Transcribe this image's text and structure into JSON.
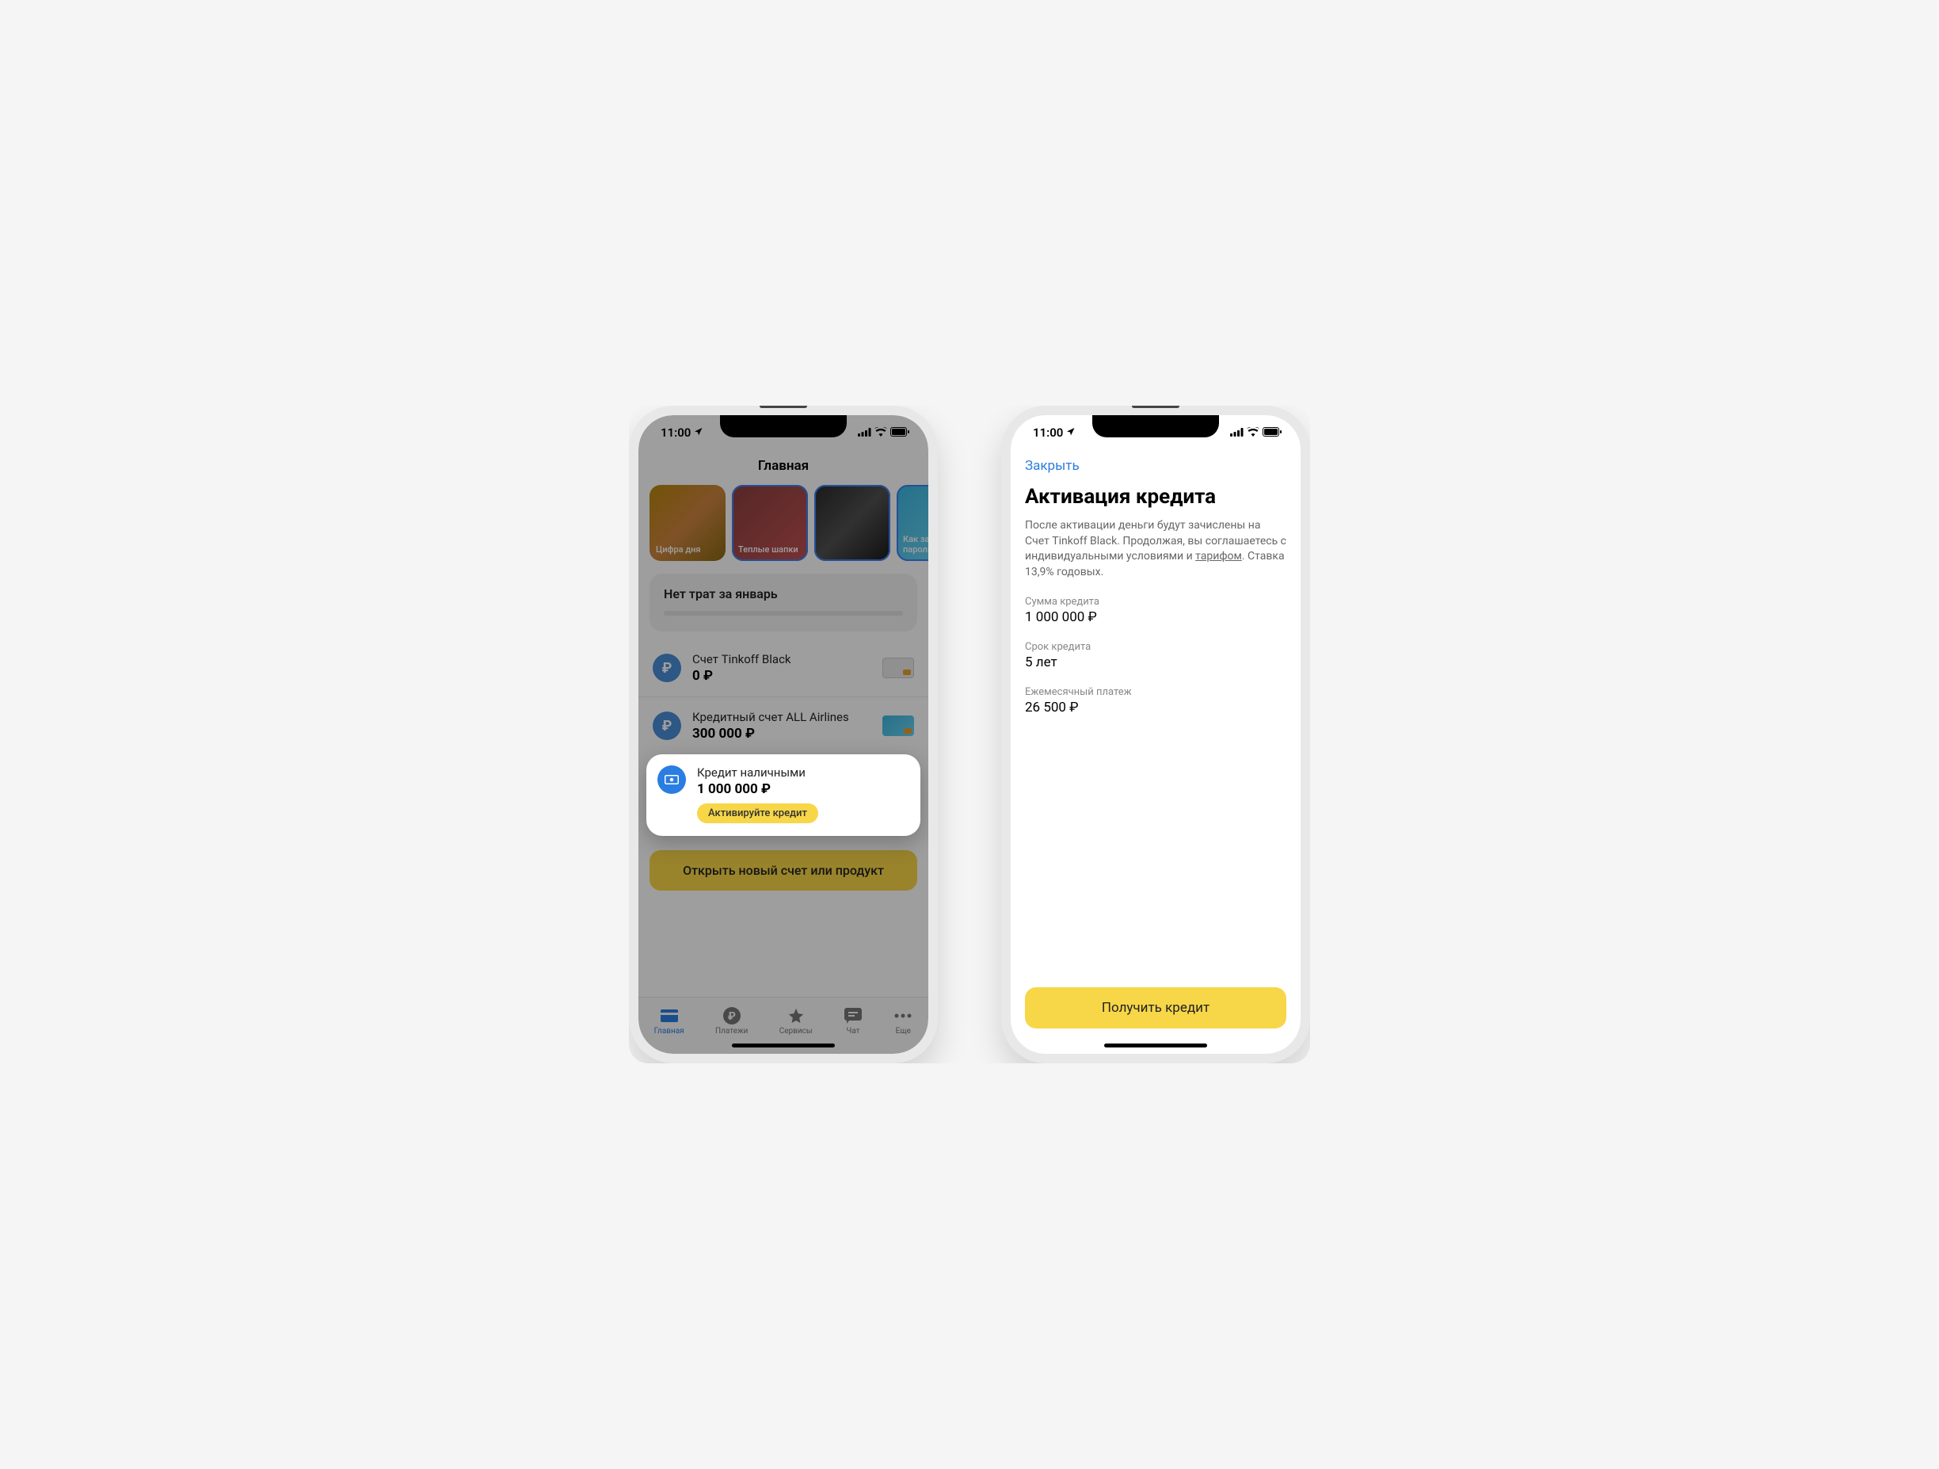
{
  "status": {
    "time": "11:00"
  },
  "left": {
    "header": "Главная",
    "stories": [
      {
        "label": "Цифра дня"
      },
      {
        "label": "Теплые шапки"
      },
      {
        "label": ""
      },
      {
        "label": "Как зап пароли"
      }
    ],
    "spend_title": "Нет трат за январь",
    "accounts": [
      {
        "name": "Счет Tinkoff Black",
        "balance": "0 ₽"
      },
      {
        "name": "Кредитный счет ALL Airlines",
        "balance": "300 000 ₽"
      }
    ],
    "highlight": {
      "name": "Кредит наличными",
      "balance": "1 000 000 ₽",
      "pill": "Активируйте кредит"
    },
    "open_new": "Открыть новый счет или продукт",
    "tabs": [
      {
        "label": "Главная"
      },
      {
        "label": "Платежи"
      },
      {
        "label": "Сервисы"
      },
      {
        "label": "Чат"
      },
      {
        "label": "Еще"
      }
    ]
  },
  "right": {
    "close": "Закрыть",
    "title": "Активация кредита",
    "desc_1": "После активации деньги будут зачислены на Счет Tinkoff Black. Продолжая, вы соглашаетесь с индивидуальными условиями и ",
    "desc_link": "тарифом",
    "desc_2": ". Ставка 13,9% годовых.",
    "details": [
      {
        "label": "Сумма кредита",
        "value": "1 000 000 ₽"
      },
      {
        "label": "Срок кредита",
        "value": "5 лет"
      },
      {
        "label": "Ежемесячный платеж",
        "value": "26 500 ₽"
      }
    ],
    "cta": "Получить кредит"
  }
}
